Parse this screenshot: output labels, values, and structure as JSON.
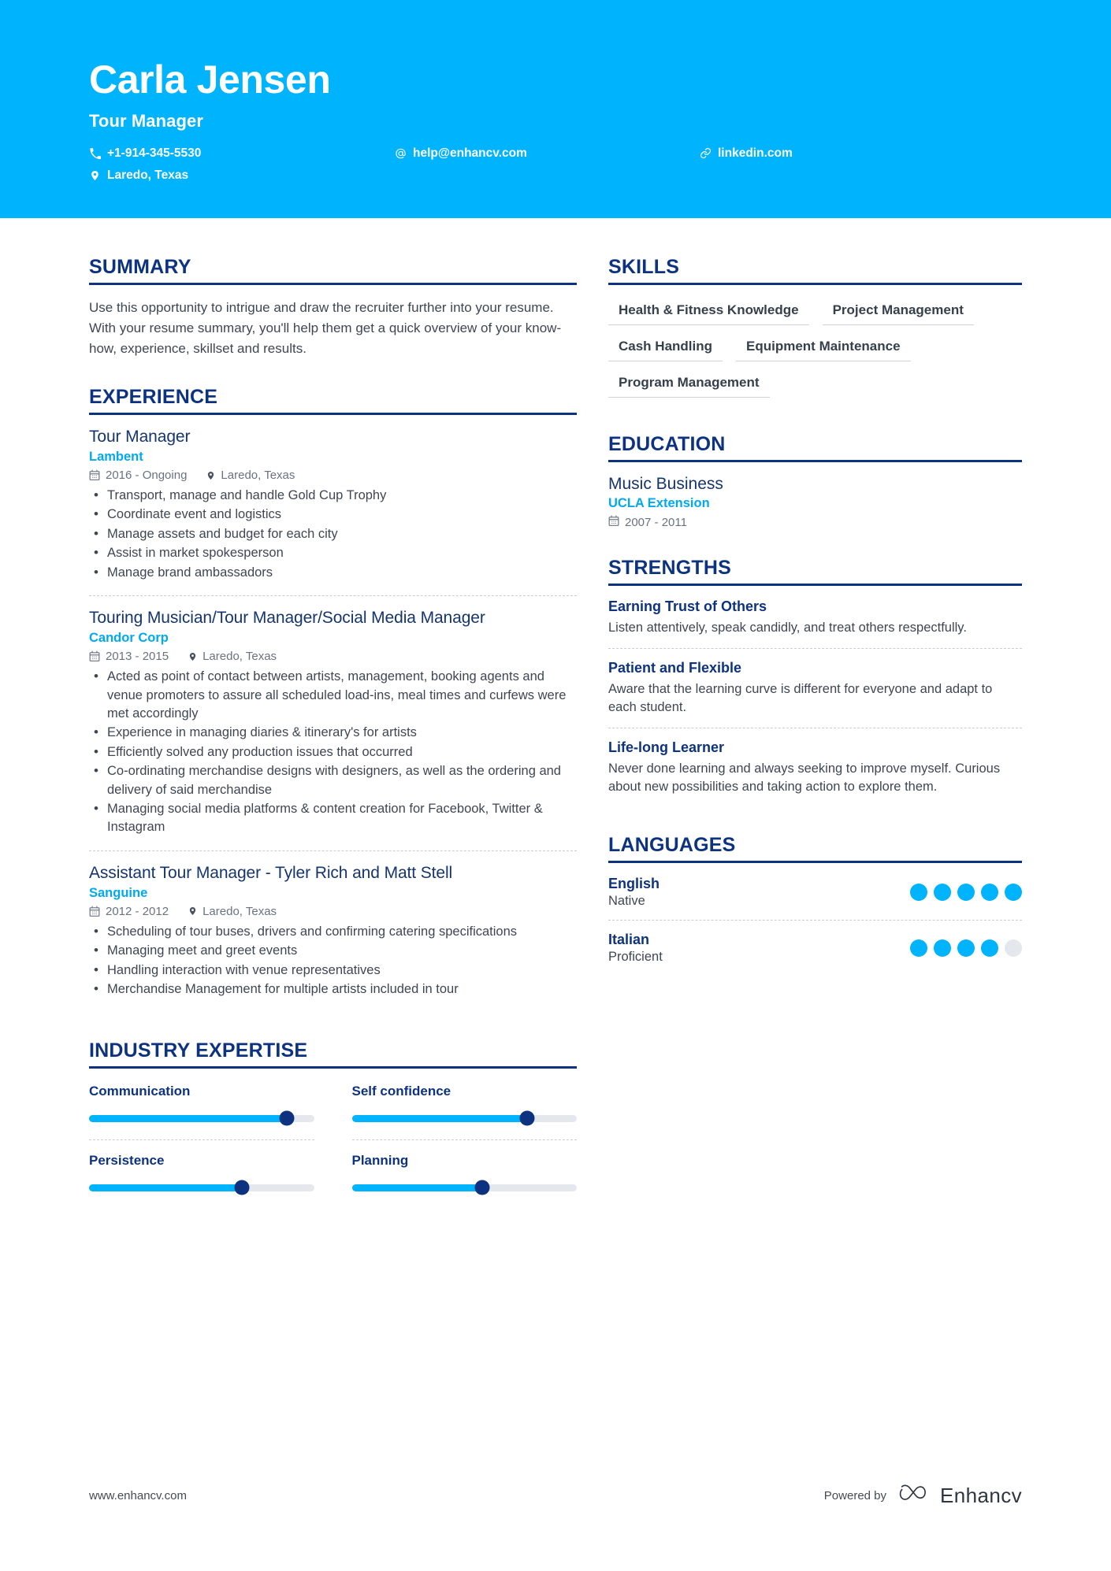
{
  "colors": {
    "header_bg": "#00b3fd",
    "navy": "#0d3380",
    "cyan_accent": "#00a9f0",
    "body_text": "#3f4653",
    "muted": "#6a7280"
  },
  "header": {
    "name": "Carla Jensen",
    "job_title": "Tour Manager",
    "contacts": {
      "phone": "+1-914-345-5530",
      "email": "help@enhancv.com",
      "link": "linkedin.com",
      "location": "Laredo, Texas"
    }
  },
  "sections": {
    "summary": {
      "heading": "SUMMARY",
      "text": "Use this opportunity to intrigue and draw the recruiter further into your resume. With your resume summary, you'll help them get a quick overview of your know-how, experience, skillset and results."
    },
    "experience": {
      "heading": "EXPERIENCE",
      "items": [
        {
          "title": "Tour Manager",
          "company": "Lambent",
          "dates": "2016 - Ongoing",
          "location": "Laredo, Texas",
          "bullets": [
            "Transport, manage and handle Gold Cup Trophy",
            "Coordinate event and logistics",
            "Manage assets and budget for each city",
            "Assist in market spokesperson",
            "Manage brand ambassadors"
          ]
        },
        {
          "title": "Touring Musician/Tour Manager/Social Media Manager",
          "company": "Candor Corp",
          "dates": "2013 - 2015",
          "location": "Laredo, Texas",
          "bullets": [
            "Acted as point of contact between artists, management, booking agents and venue promoters to assure all scheduled load-ins, meal times and curfews were met accordingly",
            "Experience in managing diaries & itinerary's for artists",
            "Efficiently solved any production issues that occurred",
            "Co-ordinating merchandise designs with designers, as well as the ordering and delivery of said merchandise",
            "Managing social media platforms & content creation for Facebook, Twitter & Instagram"
          ]
        },
        {
          "title": "Assistant Tour Manager - Tyler Rich and Matt Stell",
          "company": "Sanguine",
          "dates": "2012 - 2012",
          "location": "Laredo, Texas",
          "bullets": [
            "Scheduling of tour buses, drivers and confirming catering specifications",
            "Managing meet and greet events",
            "Handling interaction with venue representatives",
            "Merchandise Management for multiple artists included in tour"
          ]
        }
      ]
    },
    "industry_expertise": {
      "heading": "INDUSTRY EXPERTISE",
      "items": [
        {
          "label": "Communication",
          "value": 88
        },
        {
          "label": "Self confidence",
          "value": 78
        },
        {
          "label": "Persistence",
          "value": 68
        },
        {
          "label": "Planning",
          "value": 58
        }
      ]
    },
    "skills": {
      "heading": "SKILLS",
      "items": [
        "Health & Fitness Knowledge",
        "Project Management",
        "Cash Handling",
        "Equipment Maintenance",
        "Program Management"
      ]
    },
    "education": {
      "heading": "EDUCATION",
      "items": [
        {
          "degree": "Music Business",
          "school": "UCLA Extension",
          "dates": "2007 - 2011"
        }
      ]
    },
    "strengths": {
      "heading": "STRENGTHS",
      "items": [
        {
          "title": "Earning Trust of Others",
          "description": "Listen attentively, speak candidly, and treat others respectfully."
        },
        {
          "title": "Patient and Flexible",
          "description": "Aware that the learning curve is different for everyone and adapt to each student."
        },
        {
          "title": "Life-long Learner",
          "description": "Never done learning and always seeking to improve myself. Curious about new possibilities and taking action to explore them."
        }
      ]
    },
    "languages": {
      "heading": "LANGUAGES",
      "items": [
        {
          "name": "English",
          "level": "Native",
          "rating": 5,
          "max": 5
        },
        {
          "name": "Italian",
          "level": "Proficient",
          "rating": 4,
          "max": 5
        }
      ]
    }
  },
  "footer": {
    "url": "www.enhancv.com",
    "powered_by": "Powered by",
    "brand": "Enhancv"
  }
}
